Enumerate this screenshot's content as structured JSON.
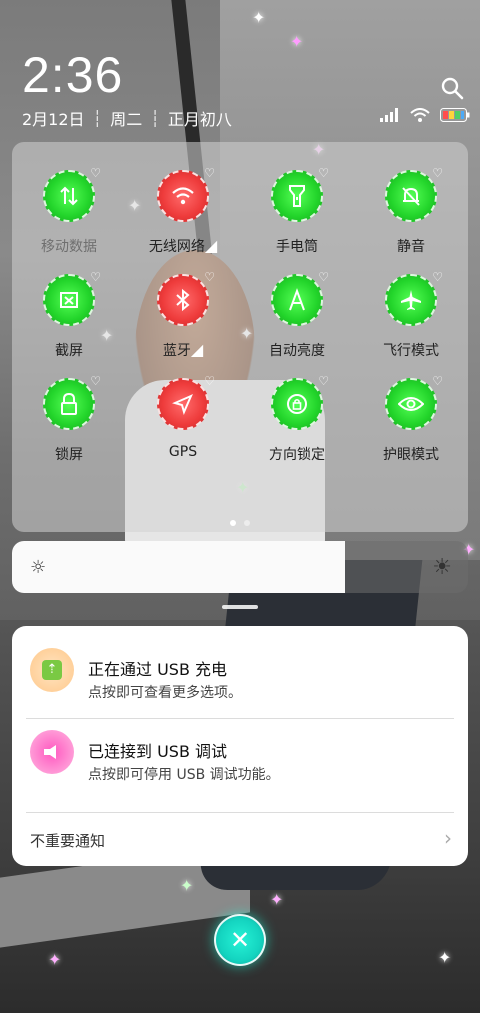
{
  "status": {
    "time": "2:36",
    "date": "2月12日",
    "weekday": "周二",
    "lunar": "正月初八"
  },
  "quick_settings": {
    "tiles": [
      {
        "label": "移动数据",
        "icon": "mobile-data-icon",
        "color": "#22d42a",
        "active": false
      },
      {
        "label": "无线网络",
        "icon": "wifi-icon",
        "color": "#ee3b3b",
        "active": true
      },
      {
        "label": "手电筒",
        "icon": "flashlight-icon",
        "color": "#22d42a",
        "active": true
      },
      {
        "label": "静音",
        "icon": "mute-bell-icon",
        "color": "#22d42a",
        "active": true
      },
      {
        "label": "截屏",
        "icon": "screenshot-icon",
        "color": "#22d42a",
        "active": true
      },
      {
        "label": "蓝牙",
        "icon": "bluetooth-icon",
        "color": "#ee3b3b",
        "active": true
      },
      {
        "label": "自动亮度",
        "icon": "auto-brightness-icon",
        "color": "#22d42a",
        "active": true
      },
      {
        "label": "飞行模式",
        "icon": "airplane-icon",
        "color": "#22d42a",
        "active": true
      },
      {
        "label": "锁屏",
        "icon": "lock-icon",
        "color": "#22d42a",
        "active": true
      },
      {
        "label": "GPS",
        "icon": "gps-icon",
        "color": "#ee3b3b",
        "active": true
      },
      {
        "label": "方向锁定",
        "icon": "rotation-lock-icon",
        "color": "#22d42a",
        "active": true
      },
      {
        "label": "护眼模式",
        "icon": "eye-icon",
        "color": "#22d42a",
        "active": true
      }
    ],
    "pages": 2,
    "current_page": 1
  },
  "brightness": {
    "level": 0.73
  },
  "notifications": [
    {
      "title": "正在通过 USB 充电",
      "body": "点按即可查看更多选项。",
      "icon": "usb-charging-icon",
      "icon_color": "#7ac943"
    },
    {
      "title": "已连接到 USB 调试",
      "body": "点按即可停用 USB 调试功能。",
      "icon": "usb-debug-icon",
      "icon_color": "#ff3fae"
    }
  ],
  "footer": {
    "label": "不重要通知"
  },
  "accent": "#14d4c0"
}
